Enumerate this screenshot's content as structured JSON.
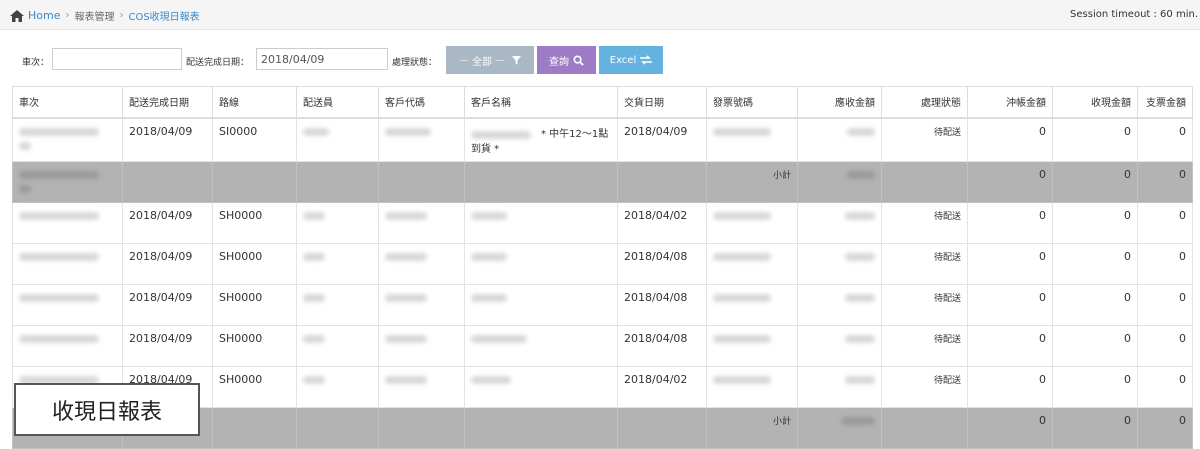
{
  "breadcrumb": {
    "home": "Home",
    "level1": "報表管理",
    "level2": "COS收現日報表"
  },
  "session": "Session timeout : 60 min.",
  "filters": {
    "car_label": "車次：",
    "car_value": "",
    "date_label": "配送完成日期：",
    "date_value": "2018/04/09",
    "status_label": "處理狀態：",
    "status_value": "全部",
    "query_label": "查詢",
    "excel_label": "Excel"
  },
  "table": {
    "headers": [
      "車次",
      "配送完成日期",
      "路線",
      "配送員",
      "客戶代碼",
      "客戶名稱",
      "交貨日期",
      "發票號碼",
      "應收金額",
      "處理狀態",
      "沖帳金額",
      "收現金額",
      "支票金額"
    ],
    "rows": [
      {
        "type": "data",
        "date": "2018/04/09",
        "route": "SI0000",
        "customer_name": "　* 中午12～1點到貨 *",
        "delivery_date": "2018/04/09",
        "status": "待配送",
        "writeoff": "0",
        "cash": "0",
        "check": "0"
      },
      {
        "type": "subtotal",
        "label": "小計",
        "writeoff": "0",
        "cash": "0",
        "check": "0"
      },
      {
        "type": "data",
        "date": "2018/04/09",
        "route": "SH0000",
        "customer_name": "",
        "delivery_date": "2018/04/02",
        "status": "待配送",
        "writeoff": "0",
        "cash": "0",
        "check": "0"
      },
      {
        "type": "data",
        "date": "2018/04/09",
        "route": "SH0000",
        "customer_name": "",
        "delivery_date": "2018/04/08",
        "status": "待配送",
        "writeoff": "0",
        "cash": "0",
        "check": "0"
      },
      {
        "type": "data",
        "date": "2018/04/09",
        "route": "SH0000",
        "customer_name": "",
        "delivery_date": "2018/04/08",
        "status": "待配送",
        "writeoff": "0",
        "cash": "0",
        "check": "0"
      },
      {
        "type": "data",
        "date": "2018/04/09",
        "route": "SH0000",
        "customer_name": "",
        "delivery_date": "2018/04/08",
        "status": "待配送",
        "writeoff": "0",
        "cash": "0",
        "check": "0"
      },
      {
        "type": "data",
        "date": "2018/04/09",
        "route": "SH0000",
        "customer_name": "",
        "delivery_date": "2018/04/02",
        "status": "待配送",
        "writeoff": "0",
        "cash": "0",
        "check": "0"
      },
      {
        "type": "subtotal",
        "label": "小計",
        "writeoff": "0",
        "cash": "0",
        "check": "0"
      }
    ]
  },
  "overlay_title": "收現日報表",
  "icons": {
    "home": "home-icon",
    "filter": "filter-icon",
    "search": "search-icon",
    "exchange": "exchange-icon"
  },
  "colors": {
    "link": "#3a87c8",
    "btn_all": "#aab7c4",
    "btn_query": "#9d7bc6",
    "btn_excel": "#63b2e0",
    "subtotal_bg": "#b3b3b3"
  }
}
